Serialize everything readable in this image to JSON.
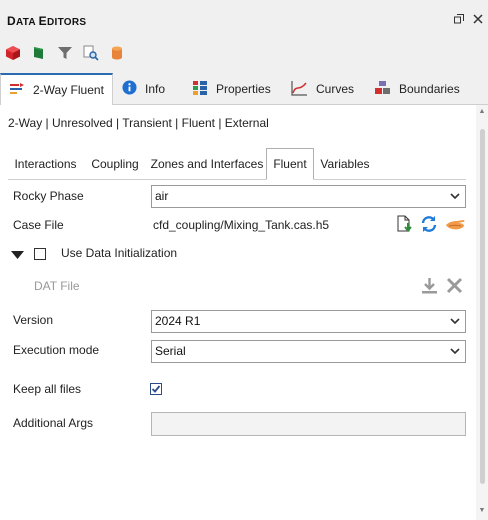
{
  "window": {
    "title_first": "D",
    "title_rest": "ATA ",
    "title_second": "E",
    "title_second_rest": "DITORS"
  },
  "toolbar": {
    "icons": [
      "red-cube-icon",
      "green-flag-icon",
      "funnel-icon",
      "search-document-icon",
      "orange-cylinder-icon"
    ]
  },
  "main_tabs": [
    {
      "label": "2-Way Fluent",
      "icon": "coupling-icon",
      "active": true
    },
    {
      "label": "Info",
      "icon": "info-icon",
      "active": false
    },
    {
      "label": "Properties",
      "icon": "properties-icon",
      "active": false
    },
    {
      "label": "Curves",
      "icon": "curves-icon",
      "active": false
    },
    {
      "label": "Boundaries",
      "icon": "boundaries-icon",
      "active": false
    }
  ],
  "breadcrumb": "2-Way | Unresolved | Transient | Fluent | External",
  "sub_tabs": [
    {
      "label": "Interactions",
      "active": false
    },
    {
      "label": "Coupling",
      "active": false
    },
    {
      "label": "Zones and Interfaces",
      "active": false
    },
    {
      "label": "Fluent",
      "active": true
    },
    {
      "label": "Variables",
      "active": false
    }
  ],
  "form": {
    "rocky_phase": {
      "label": "Rocky Phase",
      "value": "air"
    },
    "case_file": {
      "label": "Case File",
      "value": "cfd_coupling/Mixing_Tank.cas.h5"
    },
    "use_data_init": {
      "label": "Use Data Initialization",
      "checked": false
    },
    "dat_file": {
      "label": "DAT File"
    },
    "version": {
      "label": "Version",
      "value": "2024 R1"
    },
    "execution_mode": {
      "label": "Execution mode",
      "value": "Serial"
    },
    "keep_all_files": {
      "label": "Keep all files",
      "checked": true
    },
    "additional_args": {
      "label": "Additional Args",
      "value": ""
    }
  },
  "colors": {
    "accent": "#2b6cb0",
    "refresh_blue": "#1e7bd8",
    "download_green": "#2e8b3a",
    "hand_orange": "#e8833a"
  }
}
